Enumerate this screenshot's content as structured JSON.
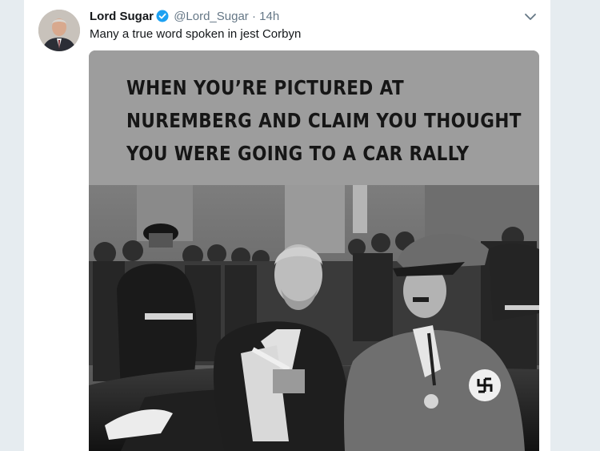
{
  "tweet": {
    "author_name": "Lord Sugar",
    "handle": "@Lord_Sugar",
    "separator": "·",
    "time": "14h",
    "text": "Many a true word spoken in jest Corbyn",
    "verified": true,
    "avatar_icon": "profile-photo",
    "menu_icon": "chevron-down-icon"
  },
  "media": {
    "caption_lines": [
      "WHEN YOU’RE PICTURED AT",
      "NUREMBERG AND CLAIM YOU THOUGHT",
      "YOU WERE GOING TO A CAR RALLY"
    ]
  },
  "colors": {
    "background": "#e6ecf0",
    "text": "#14171a",
    "secondary": "#657786",
    "verified_badge": "#1da1f2",
    "caption_background": "#9d9d9d"
  }
}
